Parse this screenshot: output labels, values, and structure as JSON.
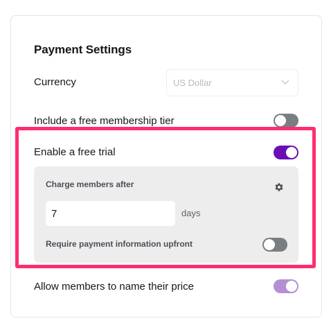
{
  "settings": {
    "title": "Payment Settings",
    "currency": {
      "label": "Currency",
      "value": "US Dollar"
    },
    "free_tier": {
      "label": "Include a free membership tier",
      "enabled": false
    },
    "free_trial": {
      "label": "Enable a free trial",
      "enabled": true,
      "charge_after_label": "Charge members after",
      "days_value": "7",
      "days_unit": "days",
      "require_payment_label": "Require payment information upfront",
      "require_payment_enabled": false
    },
    "name_price": {
      "label": "Allow members to name their price",
      "enabled": true
    }
  },
  "colors": {
    "toggle_on": "#6a0fb5",
    "toggle_on_light": "#b48fd4",
    "toggle_off": "#797e83",
    "highlight": "#ff2d6e",
    "panel_bg": "#ededed"
  },
  "icons": {
    "select_chevron": "chevron-down-icon",
    "panel_settings": "gear-icon"
  }
}
